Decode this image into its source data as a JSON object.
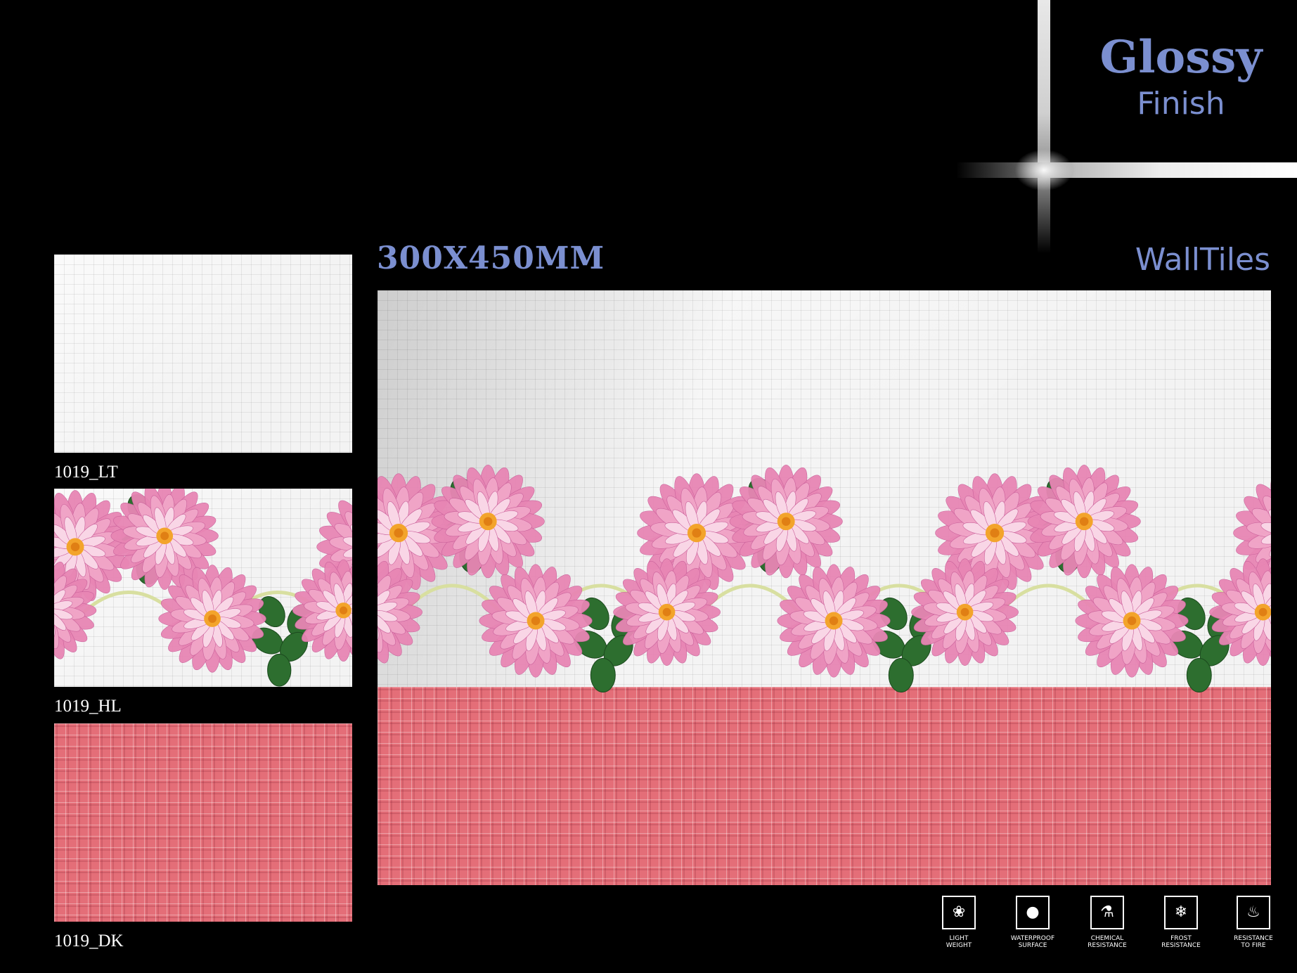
{
  "finish": {
    "line1": "Glossy",
    "line2": "Finish"
  },
  "size": "300X450MM",
  "category": "WallTiles",
  "thumbnails": [
    {
      "code": "1019_LT",
      "variant": "light"
    },
    {
      "code": "1019_HL",
      "variant": "highlighter"
    },
    {
      "code": "1019_DK",
      "variant": "dark"
    }
  ],
  "features": [
    {
      "icon": "feather-icon",
      "glyph": "❀",
      "caption": "LIGHT\nWEIGHT"
    },
    {
      "icon": "water-drop-icon",
      "glyph": "●",
      "caption": "WATERPROOF\nSURFACE"
    },
    {
      "icon": "flask-icon",
      "glyph": "⚗",
      "caption": "CHEMICAL\nRESISTANCE"
    },
    {
      "icon": "snowflake-icon",
      "glyph": "❄",
      "caption": "FROST\nRESISTANCE"
    },
    {
      "icon": "flame-icon",
      "glyph": "♨",
      "caption": "RESISTANCE\nTO FIRE"
    }
  ],
  "colors": {
    "accent": "#7b8fd0",
    "tile_white": "#f3f3f3",
    "tile_pink": "#e46e78",
    "petal": "#e886b4",
    "petal_center": "#f3a42b",
    "leaf": "#2d6e2f",
    "stem": "#d8dfa0"
  }
}
